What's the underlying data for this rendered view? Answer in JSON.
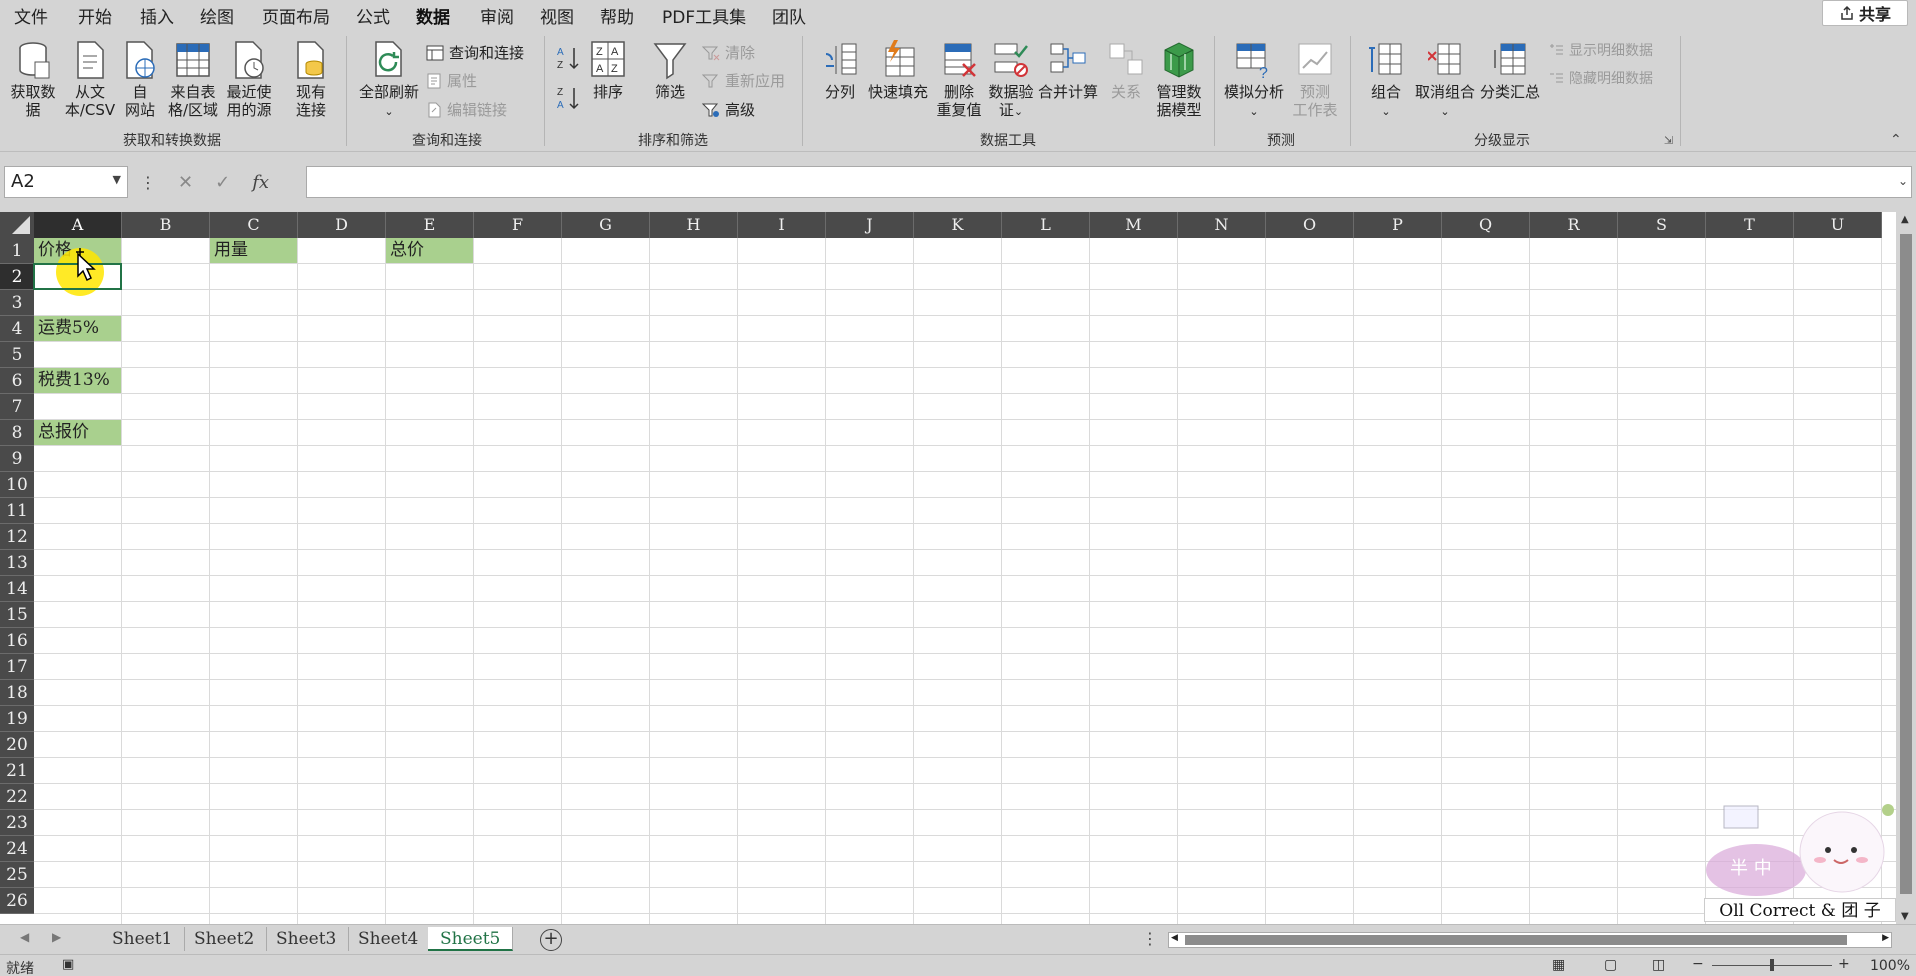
{
  "menu": {
    "tabs": [
      "文件",
      "开始",
      "插入",
      "绘图",
      "页面布局",
      "公式",
      "数据",
      "审阅",
      "视图",
      "帮助",
      "PDF工具集",
      "团队"
    ],
    "active": "数据",
    "share_label": "共享"
  },
  "ribbon": {
    "get_transform": {
      "get_data": "获取数\n据",
      "from_text": "从文\n本/CSV",
      "from_web": "自\n网站",
      "from_table": "来自表\n格/区域",
      "recent_sources": "最近使\n用的源",
      "existing_conn": "现有\n连接",
      "label": "获取和转换数据"
    },
    "queries": {
      "refresh_all": "全部刷新",
      "queries_conn": "查询和连接",
      "properties": "属性",
      "edit_links": "编辑链接",
      "label": "查询和连接"
    },
    "sort_filter": {
      "sort": "排序",
      "filter": "筛选",
      "clear": "清除",
      "reapply": "重新应用",
      "advanced": "高级",
      "label": "排序和筛选"
    },
    "data_tools": {
      "text_to_cols": "分列",
      "flash_fill": "快速填充",
      "remove_dup": "删除\n重复值",
      "validation": "数据验\n证",
      "consolidate": "合并计算",
      "relationships": "关系",
      "manage_model": "管理数\n据模型",
      "label": "数据工具"
    },
    "forecast": {
      "what_if": "模拟分析",
      "forecast_sheet": "预测\n工作表",
      "label": "预测"
    },
    "outline": {
      "group": "组合",
      "ungroup": "取消组合",
      "subtotal": "分类汇总",
      "show_detail": "显示明细数据",
      "hide_detail": "隐藏明细数据",
      "label": "分级显示"
    }
  },
  "formula_bar": {
    "name_box": "A2",
    "fx": "fx",
    "content": ""
  },
  "columns": [
    "A",
    "B",
    "C",
    "D",
    "E",
    "F",
    "G",
    "H",
    "I",
    "J",
    "K",
    "L",
    "M",
    "N",
    "O",
    "P",
    "Q",
    "R",
    "S",
    "T",
    "U"
  ],
  "rows": [
    "1",
    "2",
    "3",
    "4",
    "5",
    "6",
    "7",
    "8",
    "9",
    "10",
    "11",
    "12",
    "13",
    "14",
    "15",
    "16",
    "17",
    "18",
    "19",
    "20",
    "21",
    "22",
    "23",
    "24",
    "25",
    "26"
  ],
  "cells": {
    "A1": "价格",
    "C1": "用量",
    "E1": "总价",
    "A4": "运费5%",
    "A6": "税费13%",
    "A8": "总报价"
  },
  "colors": {
    "header_fill": "#a9d08e",
    "selection": "#217346",
    "cursor_highlight": "#ffe600"
  },
  "sheets": [
    "Sheet1",
    "Sheet2",
    "Sheet3",
    "Sheet4",
    "Sheet5"
  ],
  "active_sheet": "Sheet5",
  "status": {
    "mode": "就绪",
    "zoom": "100%"
  },
  "watermark": {
    "badge_text": "半 中",
    "signature": "Oll Correct & 团 子"
  }
}
